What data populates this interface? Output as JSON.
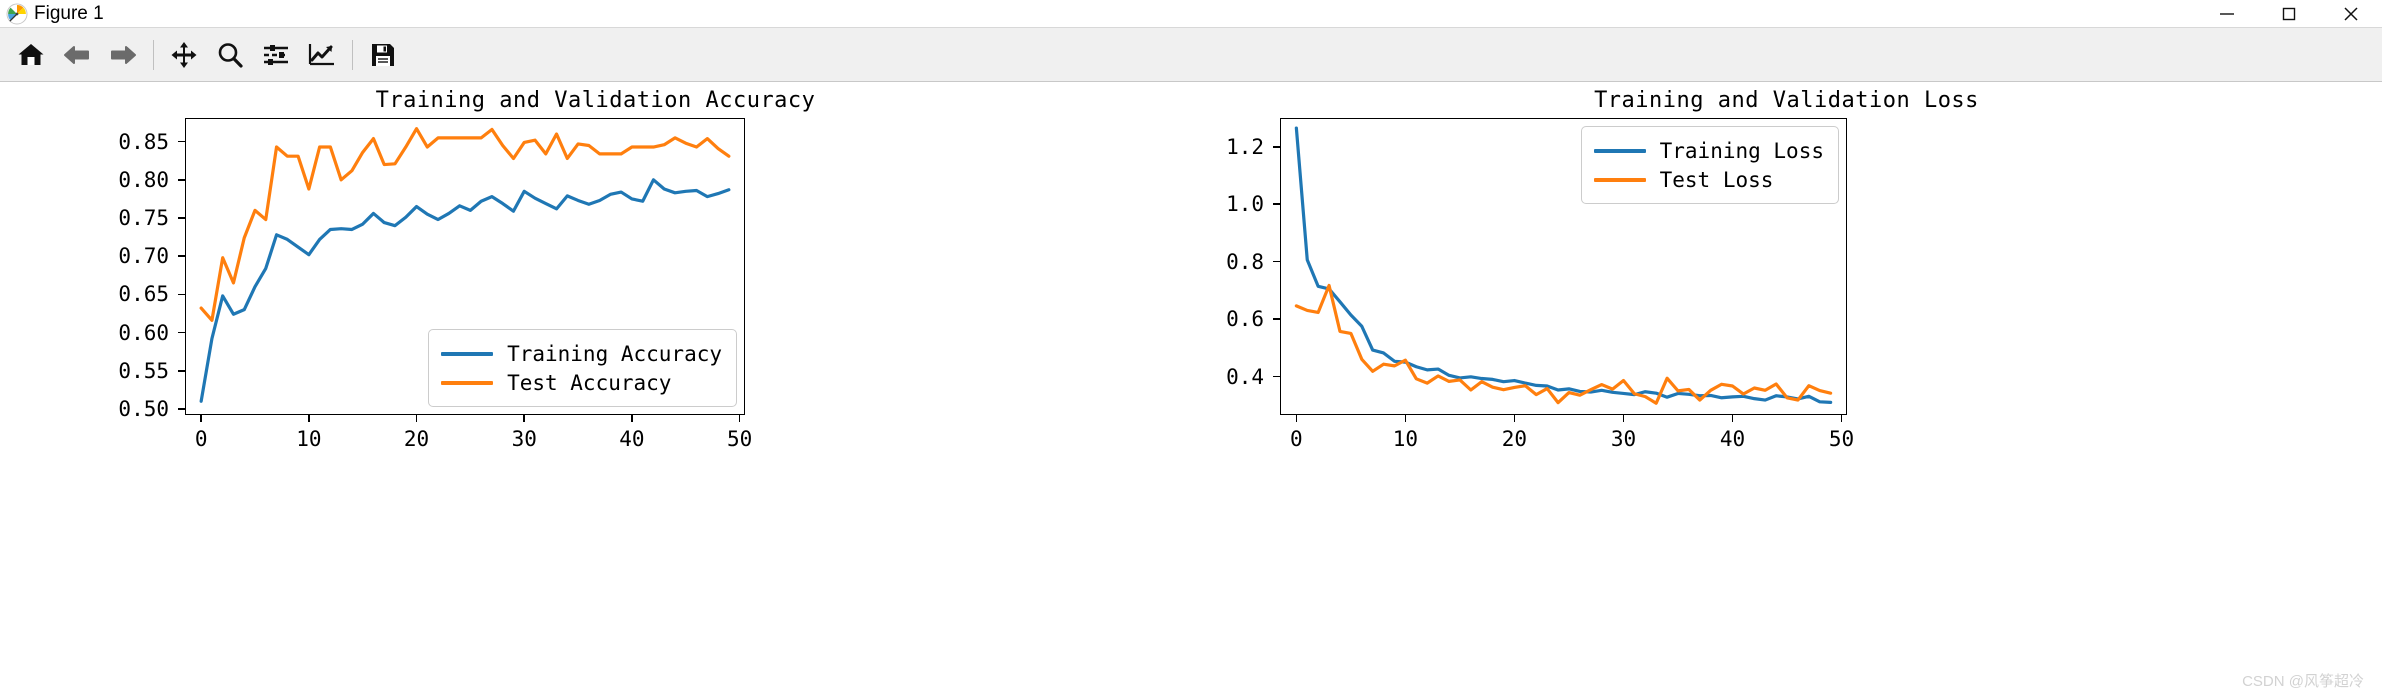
{
  "window": {
    "title": "Figure 1",
    "icon": "matplotlib-icon",
    "minimize_label": "─",
    "maximize_label": "□",
    "close_label": "✕"
  },
  "toolbar": {
    "buttons": [
      {
        "name": "home-button",
        "label": "Home",
        "icon": "home-icon"
      },
      {
        "name": "back-button",
        "label": "Back",
        "icon": "arrow-left-icon"
      },
      {
        "name": "forward-button",
        "label": "Forward",
        "icon": "arrow-right-icon"
      },
      {
        "name": "pan-button",
        "label": "Pan",
        "icon": "move-arrows-icon"
      },
      {
        "name": "zoom-button",
        "label": "Zoom to rectangle",
        "icon": "magnifier-icon"
      },
      {
        "name": "configure-subplots-button",
        "label": "Configure subplots",
        "icon": "sliders-icon"
      },
      {
        "name": "edit-axis-button",
        "label": "Edit axis, curve and image parameters",
        "icon": "chart-line-icon"
      },
      {
        "name": "save-button",
        "label": "Save the figure",
        "icon": "floppy-disk-icon"
      }
    ]
  },
  "watermark": "CSDN @风筝超冷",
  "colors": {
    "training": "#1f77b4",
    "test": "#ff7f0e",
    "axis": "#000000",
    "toolbar_bg": "#f0f0f0"
  },
  "chart_data": [
    {
      "type": "line",
      "id": "accuracy",
      "title": "Training and Validation Accuracy",
      "xlabel": "",
      "ylabel": "",
      "xlim": [
        -1.5,
        50.5
      ],
      "ylim": [
        0.492,
        0.881
      ],
      "xticks": [
        0,
        10,
        20,
        30,
        40,
        50
      ],
      "yticks": [
        0.5,
        0.55,
        0.6,
        0.65,
        0.7,
        0.75,
        0.8,
        0.85
      ],
      "ytick_labels": [
        "0.50",
        "0.55",
        "0.60",
        "0.65",
        "0.70",
        "0.75",
        "0.80",
        "0.85"
      ],
      "xtick_labels": [
        "0",
        "10",
        "20",
        "30",
        "40",
        "50"
      ],
      "grid": false,
      "legend_position": "lower right",
      "x": [
        0,
        1,
        2,
        3,
        4,
        5,
        6,
        7,
        8,
        9,
        10,
        11,
        12,
        13,
        14,
        15,
        16,
        17,
        18,
        19,
        20,
        21,
        22,
        23,
        24,
        25,
        26,
        27,
        28,
        29,
        30,
        31,
        32,
        33,
        34,
        35,
        36,
        37,
        38,
        39,
        40,
        41,
        42,
        43,
        44,
        45,
        46,
        47,
        48,
        49
      ],
      "series": [
        {
          "name": "Training Accuracy",
          "color": "#1f77b4",
          "values": [
            0.51,
            0.592,
            0.648,
            0.624,
            0.63,
            0.66,
            0.684,
            0.728,
            0.722,
            0.712,
            0.702,
            0.722,
            0.735,
            0.736,
            0.735,
            0.742,
            0.756,
            0.744,
            0.74,
            0.751,
            0.765,
            0.755,
            0.748,
            0.756,
            0.766,
            0.76,
            0.772,
            0.778,
            0.769,
            0.759,
            0.785,
            0.776,
            0.769,
            0.762,
            0.779,
            0.773,
            0.768,
            0.773,
            0.781,
            0.784,
            0.775,
            0.772,
            0.8,
            0.788,
            0.783,
            0.785,
            0.786,
            0.778,
            0.782,
            0.787
          ]
        },
        {
          "name": "Test Accuracy",
          "color": "#ff7f0e",
          "values": [
            0.632,
            0.616,
            0.698,
            0.665,
            0.724,
            0.76,
            0.748,
            0.843,
            0.831,
            0.831,
            0.788,
            0.843,
            0.843,
            0.8,
            0.812,
            0.836,
            0.854,
            0.82,
            0.821,
            0.843,
            0.867,
            0.843,
            0.855,
            0.855,
            0.855,
            0.855,
            0.855,
            0.866,
            0.845,
            0.828,
            0.849,
            0.852,
            0.834,
            0.86,
            0.828,
            0.847,
            0.845,
            0.834,
            0.834,
            0.834,
            0.843,
            0.843,
            0.843,
            0.846,
            0.855,
            0.848,
            0.843,
            0.854,
            0.841,
            0.831
          ]
        }
      ]
    },
    {
      "type": "line",
      "id": "loss",
      "title": "Training and Validation Loss",
      "xlabel": "",
      "ylabel": "",
      "xlim": [
        -1.5,
        50.5
      ],
      "ylim": [
        0.266,
        1.3
      ],
      "xticks": [
        0,
        10,
        20,
        30,
        40,
        50
      ],
      "yticks": [
        0.4,
        0.6,
        0.8,
        1.0,
        1.2
      ],
      "ytick_labels": [
        "0.4",
        "0.6",
        "0.8",
        "1.0",
        "1.2"
      ],
      "xtick_labels": [
        "0",
        "10",
        "20",
        "30",
        "40",
        "50"
      ],
      "grid": false,
      "legend_position": "upper right",
      "x": [
        0,
        1,
        2,
        3,
        4,
        5,
        6,
        7,
        8,
        9,
        10,
        11,
        12,
        13,
        14,
        15,
        16,
        17,
        18,
        19,
        20,
        21,
        22,
        23,
        24,
        25,
        26,
        27,
        28,
        29,
        30,
        31,
        32,
        33,
        34,
        35,
        36,
        37,
        38,
        39,
        40,
        41,
        42,
        43,
        44,
        45,
        46,
        47,
        48,
        49
      ],
      "series": [
        {
          "name": "Training Loss",
          "color": "#1f77b4",
          "values": [
            1.265,
            0.806,
            0.714,
            0.705,
            0.66,
            0.614,
            0.575,
            0.492,
            0.482,
            0.453,
            0.45,
            0.434,
            0.423,
            0.426,
            0.404,
            0.395,
            0.399,
            0.393,
            0.39,
            0.382,
            0.386,
            0.377,
            0.369,
            0.367,
            0.353,
            0.357,
            0.348,
            0.346,
            0.352,
            0.345,
            0.341,
            0.337,
            0.347,
            0.342,
            0.328,
            0.341,
            0.338,
            0.333,
            0.334,
            0.326,
            0.329,
            0.331,
            0.323,
            0.318,
            0.333,
            0.329,
            0.322,
            0.331,
            0.312,
            0.31
          ]
        },
        {
          "name": "Test Loss",
          "color": "#ff7f0e",
          "values": [
            0.646,
            0.63,
            0.623,
            0.717,
            0.557,
            0.55,
            0.46,
            0.418,
            0.443,
            0.437,
            0.457,
            0.392,
            0.377,
            0.402,
            0.383,
            0.388,
            0.353,
            0.382,
            0.363,
            0.354,
            0.362,
            0.368,
            0.337,
            0.358,
            0.309,
            0.344,
            0.335,
            0.354,
            0.372,
            0.356,
            0.386,
            0.34,
            0.33,
            0.307,
            0.394,
            0.35,
            0.355,
            0.318,
            0.352,
            0.373,
            0.367,
            0.339,
            0.36,
            0.352,
            0.374,
            0.326,
            0.318,
            0.368,
            0.351,
            0.342
          ]
        }
      ]
    }
  ]
}
